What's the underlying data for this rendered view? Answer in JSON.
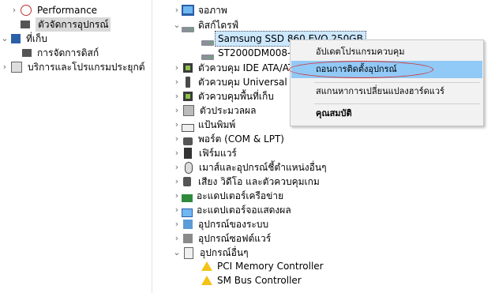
{
  "left_tree": [
    {
      "label": "Performance",
      "icon": "performance-icon"
    },
    {
      "label": "ตัวจัดการอุปกรณ์",
      "icon": "device-manager-icon"
    },
    {
      "label": "ที่เก็บ",
      "icon": "storage-icon"
    },
    {
      "label": "การจัดการดิสก์",
      "icon": "disk-management-icon"
    },
    {
      "label": "บริการและโปรแกรมประยุกต์",
      "icon": "services-icon"
    }
  ],
  "device_tree": {
    "monitors": "จอภาพ",
    "disk_drives": "ดิสก์ไดรฟ์",
    "disk1": "Samsung SSD 860 EVO 250GB",
    "disk2": "ST2000DM008-2FR",
    "ide": "ตัวควบคุม IDE ATA/AT",
    "usb": "ตัวควบคุม Universal Se",
    "storage_ctrl": "ตัวควบคุมพื้นที่เก็บ",
    "processors": "ตัวประมวลผล",
    "keyboards": "แป้นพิมพ์",
    "ports": "พอร์ต (COM & LPT)",
    "firmware": "เฟิร์มแวร์",
    "mice": "เมาส์และอุปกรณ์ชี้ตำแหน่งอื่นๆ",
    "sound": "เสียง วิดีโอ และตัวควบคุมเกม",
    "network": "อะแดปเตอร์เครือข่าย",
    "display": "อะแดปเตอร์จอแสดงผล",
    "system": "อุปกรณ์ของระบบ",
    "software": "อุปกรณ์ซอฟต์แวร์",
    "other": "อุปกรณ์อื่นๆ",
    "pci": "PCI Memory Controller",
    "smbus": "SM Bus Controller"
  },
  "context_menu": {
    "update_driver": "อัปเดตโปรแกรมควบคุม",
    "uninstall": "ถอนการติดตั้งอุปกรณ์",
    "scan": "สแกนหาการเปลี่ยนแปลงฮาร์ดแวร์",
    "properties": "คุณสมบัติ"
  }
}
